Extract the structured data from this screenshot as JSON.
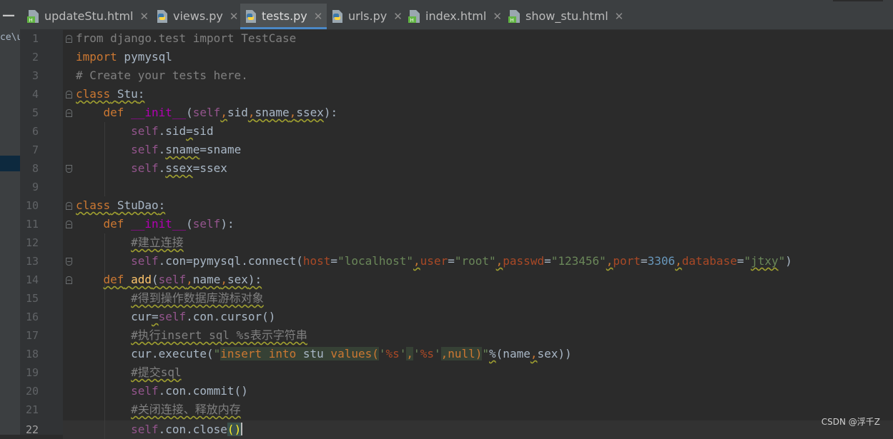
{
  "tabs": [
    {
      "label": "updateStu.html",
      "icon": "html-file-icon",
      "active": false
    },
    {
      "label": "views.py",
      "icon": "python-file-icon",
      "active": false
    },
    {
      "label": "tests.py",
      "icon": "python-file-icon",
      "active": true
    },
    {
      "label": "urls.py",
      "icon": "python-file-icon",
      "active": false
    },
    {
      "label": "index.html",
      "icon": "html-file-icon",
      "active": false
    },
    {
      "label": "show_stu.html",
      "icon": "html-file-icon",
      "active": false
    }
  ],
  "close_glyph": "✕",
  "project_path_fragment": "ce\\u",
  "line_numbers": [
    "1",
    "2",
    "3",
    "4",
    "5",
    "6",
    "7",
    "8",
    "9",
    "10",
    "11",
    "12",
    "13",
    "14",
    "15",
    "16",
    "17",
    "18",
    "19",
    "20",
    "21",
    "22"
  ],
  "code": {
    "l1": {
      "t0": "from django.test import TestCase"
    },
    "l2": {
      "t0": "import",
      "t1": " pymysql"
    },
    "l3": {
      "t0": "# Create your tests here."
    },
    "l4": {
      "t0": "class",
      "t1": " ",
      "t2": "Stu",
      "t3": ":"
    },
    "l5": {
      "t0": "    ",
      "t1": "def",
      "t2": " ",
      "t3": "__init__",
      "t4": "(",
      "t5": "self",
      "t6": ",",
      "t7": "sid",
      "t8": ",",
      "t9": "sname",
      "t10": ",",
      "t11": "ssex",
      "t12": "):"
    },
    "l6": {
      "t0": "        ",
      "t1": "self",
      "t2": ".sid",
      "t3": "=",
      "t4": "sid"
    },
    "l7": {
      "t0": "        ",
      "t1": "self",
      "t2": ".",
      "t3": "sname",
      "t4": "=sname"
    },
    "l8": {
      "t0": "        ",
      "t1": "self",
      "t2": ".",
      "t3": "ssex",
      "t4": "=ssex"
    },
    "l10": {
      "t0": "class",
      "t1": " ",
      "t2": "StuDao",
      "t3": ":"
    },
    "l11": {
      "t0": "    ",
      "t1": "def",
      "t2": " ",
      "t3": "__init__",
      "t4": "(",
      "t5": "self",
      "t6": "):"
    },
    "l12": {
      "t0": "        ",
      "t1": "#建立连接"
    },
    "l13": {
      "t0": "        ",
      "t1": "self",
      "t2": ".con=pymysql.connect(",
      "t3": "host",
      "t4": "=",
      "t5": "\"localhost\"",
      "t6": ",",
      "t7": "user",
      "t8": "=",
      "t9": "\"root\"",
      "t10": ",",
      "t11": "passwd",
      "t12": "=",
      "t13": "\"123456\"",
      "t14": ",",
      "t15": "port",
      "t16": "=",
      "t17": "3306",
      "t18": ",",
      "t19": "database",
      "t20": "=",
      "t21": "\"",
      "t22": "jtxy",
      "t23": "\"",
      "t24": ")"
    },
    "l14": {
      "t0": "    ",
      "t1": "def",
      "t2": " ",
      "t3": "add",
      "t4": "(",
      "t5": "self",
      "t6": ",",
      "t7": "name",
      "t8": ",",
      "t9": "sex",
      "t10": "):"
    },
    "l15": {
      "t0": "        ",
      "t1": "#得到操作数据库游标对象"
    },
    "l16": {
      "t0": "        ",
      "t1": "cur",
      "t2": "=",
      "t3": "self",
      "t4": ".con.cursor()"
    },
    "l17": {
      "t0": "        ",
      "t1": "#执行insert sql %s表示字符串"
    },
    "l18": {
      "t0": "        ",
      "t1": "cur.execute(",
      "t2": "\"",
      "t3": "insert into ",
      "t4": "stu",
      "t5": " values(",
      "t6": "'",
      "t7": "%s",
      "t8": "'",
      "t9": ",",
      "t10": "'",
      "t11": "%s",
      "t12": "'",
      "t13": ",null)",
      "t14": "\"",
      "t15": "%",
      "t16": "(name",
      "t17": ",",
      "t18": "sex))"
    },
    "l19": {
      "t0": "        ",
      "t1": "#提交sql"
    },
    "l20": {
      "t0": "        ",
      "t1": "self",
      "t2": ".con.commit()"
    },
    "l21": {
      "t0": "        ",
      "t1": "#关闭连接、释放内存"
    },
    "l22": {
      "t0": "        ",
      "t1": "self",
      "t2": ".con.close",
      "t3": "(",
      "t4": ")"
    }
  },
  "watermark": "CSDN @浮千Z",
  "colors": {
    "keyword": "#cc7832",
    "function": "#ffc66d",
    "dunder": "#b200b2",
    "self": "#94558d",
    "string": "#6a8759",
    "number": "#6897bb",
    "comment": "#808080",
    "param": "#aa4926",
    "text": "#a9b7c6",
    "background": "#2b2b2b",
    "tab_accent": "#4a88c7"
  }
}
